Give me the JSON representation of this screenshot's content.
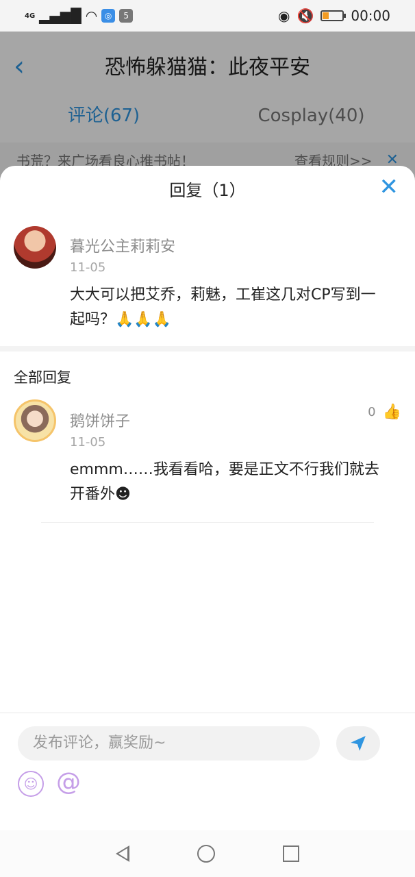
{
  "status_bar": {
    "network": "4G",
    "time": "00:00",
    "app_badge_1": "◎",
    "app_badge_2": "5"
  },
  "header": {
    "title": "恐怖躲猫猫：此夜平安",
    "back_icon": "chevron-left"
  },
  "tabs": [
    {
      "label": "评论(67)",
      "active": true
    },
    {
      "label": "Cosplay(40)",
      "active": false
    }
  ],
  "notice": {
    "text": "书荒？来广场看良心推书帖！",
    "link": "查看规则>>",
    "close": "✕"
  },
  "sheet": {
    "title": "回复（1）",
    "close": "✕",
    "comment": {
      "author": "暮光公主莉莉安",
      "date": "11-05",
      "text_main": "大大可以把艾乔，莉魅，工崔这几对CP写到一起吗？",
      "text_emoji": "🙏🙏🙏"
    },
    "section_title": "全部回复",
    "replies": [
      {
        "author": "鹅饼饼子",
        "date": "11-05",
        "text": "emmm……我看看哈，要是正文不行我们就去开番外☻",
        "likes": "0"
      }
    ]
  },
  "input": {
    "placeholder": "发布评论，赢奖励~",
    "emoji_icon": "☺",
    "at_icon": "@"
  },
  "colors": {
    "accent": "#2f95e0",
    "icon_purple": "#c59ee8",
    "battery": "#f29b22"
  }
}
